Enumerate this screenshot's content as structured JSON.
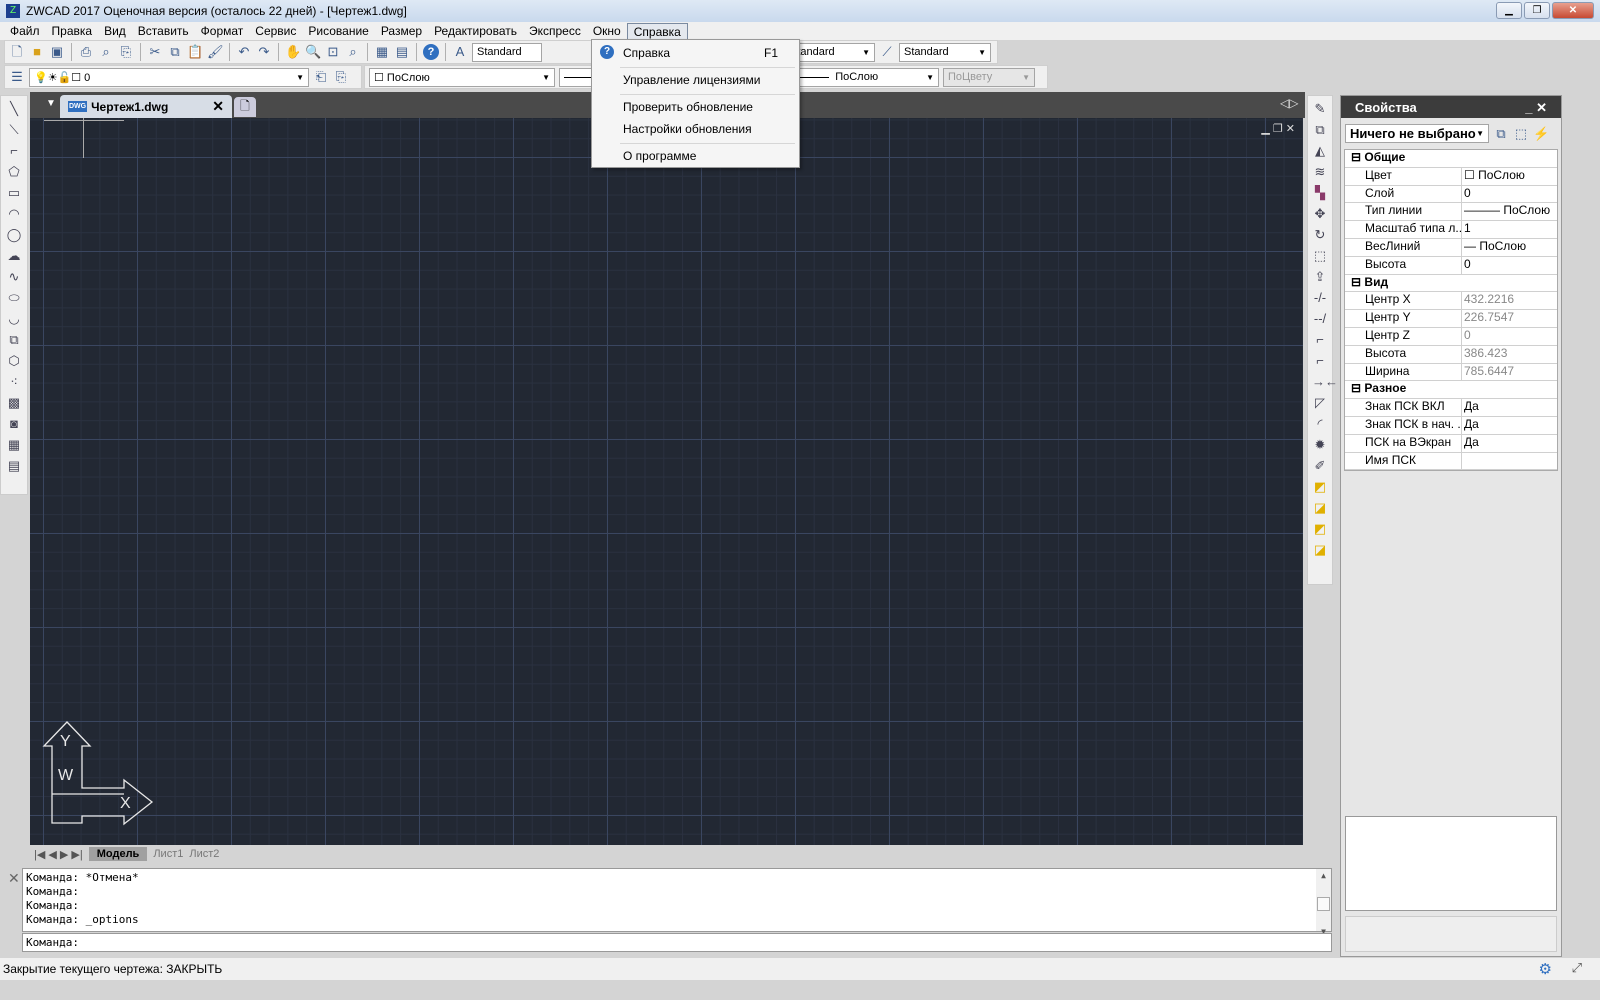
{
  "titlebar": {
    "title": "ZWCAD 2017 Оценочная версия (осталось 22 дней) - [Чертеж1.dwg]"
  },
  "menu": [
    "Файл",
    "Правка",
    "Вид",
    "Вставить",
    "Формат",
    "Сервис",
    "Рисование",
    "Размер",
    "Редактировать",
    "Экспресс",
    "Окно",
    "Справка"
  ],
  "help_menu": {
    "items": [
      {
        "label": "Справка",
        "shortcut": "F1"
      },
      {
        "label": "Управление лицензиями"
      },
      {
        "label": "Проверить обновление"
      },
      {
        "label": "Настройки обновления"
      },
      {
        "label": "О программе"
      }
    ]
  },
  "toolbar": {
    "text_style": "Standard",
    "dim_style": "Standard",
    "table_style": "Standard",
    "layer": "0",
    "color": "ПоСлою",
    "linetype": "ПоСлою",
    "plotstyle": "ПоЦвету"
  },
  "doc_tab": {
    "label": "Чертеж1.dwg",
    "icon_text": "DWG"
  },
  "ucs": {
    "y": "Y",
    "x": "X",
    "w": "W"
  },
  "layout_tabs": [
    "Модель",
    "Лист1",
    "Лист2"
  ],
  "properties": {
    "title": "Свойства",
    "selection": "Ничего не выбрано",
    "groups": [
      {
        "name": "Общие",
        "rows": [
          {
            "k": "Цвет",
            "v": "☐ ПоСлою"
          },
          {
            "k": "Слой",
            "v": "0"
          },
          {
            "k": "Тип линии",
            "v": "——— ПоСлою"
          },
          {
            "k": "Масштаб типа л...",
            "v": "1"
          },
          {
            "k": "ВесЛиний",
            "v": "— ПоСлою"
          },
          {
            "k": "Высота",
            "v": "0"
          }
        ]
      },
      {
        "name": "Вид",
        "rows": [
          {
            "k": "Центр X",
            "v": "432.2216"
          },
          {
            "k": "Центр Y",
            "v": "226.7547"
          },
          {
            "k": "Центр Z",
            "v": "0"
          },
          {
            "k": "Высота",
            "v": "386.423"
          },
          {
            "k": "Ширина",
            "v": "785.6447"
          }
        ]
      },
      {
        "name": "Разное",
        "rows": [
          {
            "k": "Знак ПСК ВКЛ",
            "v": "Да"
          },
          {
            "k": "Знак ПСК в нач. ...",
            "v": "Да"
          },
          {
            "k": "ПСК на ВЭкран",
            "v": "Да"
          },
          {
            "k": "Имя ПСК",
            "v": ""
          }
        ]
      }
    ]
  },
  "command": {
    "history": [
      "Команда:  *Отмена*",
      "Команда:",
      "Команда:",
      "Команда:  _options"
    ],
    "prompt": "Команда:"
  },
  "status": {
    "text": "Закрытие текущего чертежа:  ЗАКРЫТЬ"
  }
}
